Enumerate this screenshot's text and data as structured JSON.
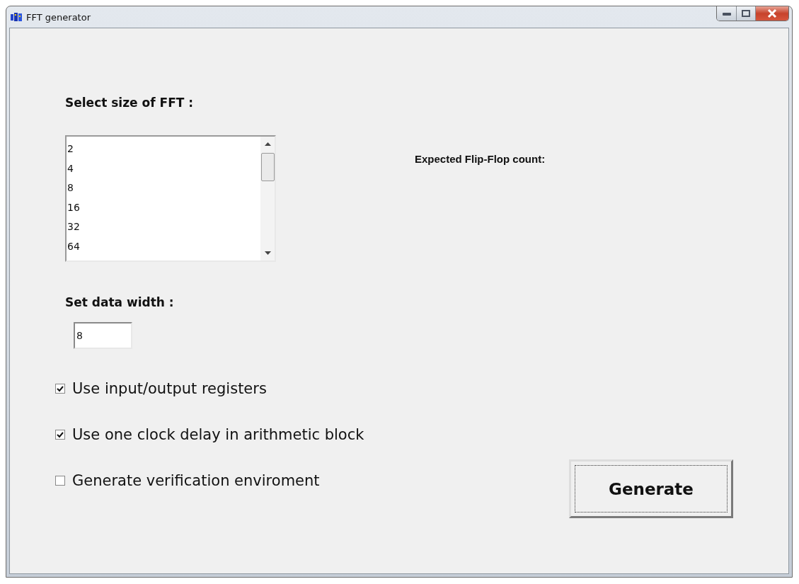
{
  "window": {
    "title": "FFT generator"
  },
  "size_label": "Select size of FFT :",
  "sizes": [
    {
      "label": "2",
      "selected": false
    },
    {
      "label": "4",
      "selected": false
    },
    {
      "label": "8",
      "selected": false
    },
    {
      "label": "16",
      "selected": false
    },
    {
      "label": "32",
      "selected": false
    },
    {
      "label": "64",
      "selected": false
    }
  ],
  "flipflop_label": "Expected Flip-Flop count:",
  "width_label": "Set data width :",
  "width_value": "8",
  "options": [
    {
      "label": "Use input/output registers",
      "checked": true
    },
    {
      "label": "Use one clock delay in arithmetic block",
      "checked": true
    },
    {
      "label": "Generate verification enviroment",
      "checked": false
    }
  ],
  "generate_button": "Generate"
}
